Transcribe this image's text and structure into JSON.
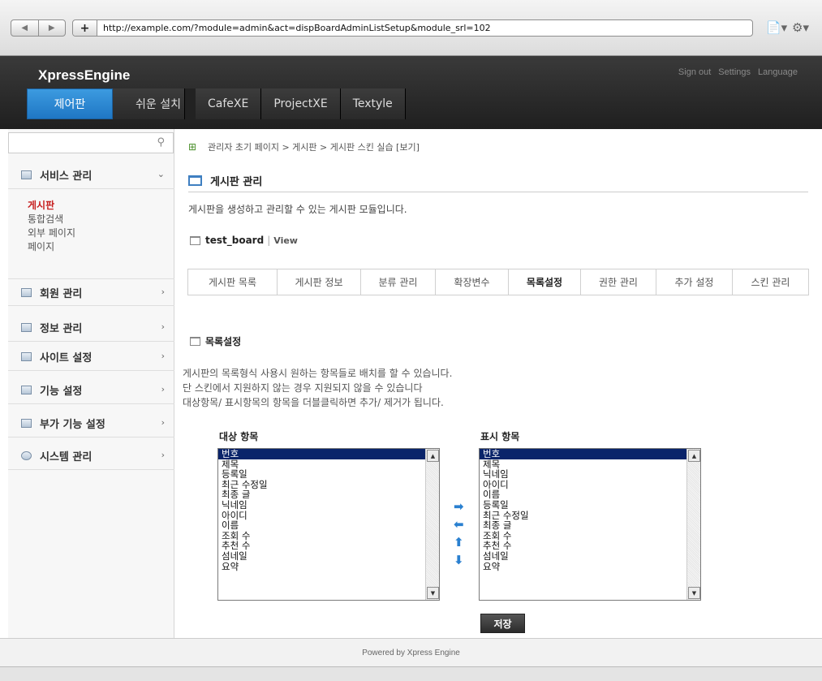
{
  "browser": {
    "url": "http://example.com/?module=admin&act=dispBoardAdminListSetup&module_srl=102",
    "back_icon": "◀",
    "forward_icon": "▶",
    "plus_icon": "+",
    "page_icon": "📄▾",
    "gear_icon": "⚙▾"
  },
  "header": {
    "logo": "XpressEngine",
    "links": [
      "Sign out",
      "Settings",
      "Language"
    ],
    "gnb": [
      "제어판",
      "쉬운 설치",
      "CafeXE",
      "ProjectXE",
      "Textyle"
    ]
  },
  "sidebar": {
    "search_placeholder": "",
    "search_icon": "🔍",
    "sections": [
      {
        "label": "서비스 관리",
        "arrow": "⌄"
      },
      {
        "label": "회원 관리",
        "arrow": "›"
      },
      {
        "label": "정보 관리",
        "arrow": "›"
      },
      {
        "label": "사이트 설정",
        "arrow": "›"
      },
      {
        "label": "기능 설정",
        "arrow": "›"
      },
      {
        "label": "부가 기능 설정",
        "arrow": "›"
      },
      {
        "label": "시스템 관리",
        "arrow": "›"
      }
    ],
    "submenu": [
      "게시판",
      "통합검색",
      "외부 페이지",
      "페이지"
    ]
  },
  "content": {
    "breadcrumb": "관리자 초기 페이지 > 게시판 > 게시판 스킨 실습 [보기]",
    "title": "게시판 관리",
    "description": "게시판을 생성하고 관리할 수 있는 게시판 모듈입니다.",
    "board_name": "test_board",
    "board_sep": "|",
    "board_view": "View",
    "tabs": [
      "게시판 목록",
      "게시판 정보",
      "분류 관리",
      "확장변수",
      "목록설정",
      "권한 관리",
      "추가 설정",
      "스킨 관리"
    ],
    "active_tab": "목록설정",
    "section_title": "목록설정",
    "help": [
      "게시판의 목록형식 사용시 원하는 항목들로 배치를 할 수 있습니다.",
      "단 스킨에서 지원하지 않는 경우 지원되지 않을 수 있습니다",
      "대상항목/ 표시항목의 항목을 더블클릭하면 추가/ 제거가 됩니다."
    ],
    "target_label": "대상 항목",
    "display_label": "표시 항목",
    "target_items": [
      "번호",
      "제목",
      "등록일",
      "최근 수정일",
      "최종 글",
      "닉네임",
      "아이디",
      "이름",
      "조회 수",
      "추천 수",
      "섬네일",
      "요약"
    ],
    "display_items": [
      "번호",
      "제목",
      "닉네임",
      "아이디",
      "이름",
      "등록일",
      "최근 수정일",
      "최종 글",
      "조회 수",
      "추천 수",
      "섬네일",
      "요약"
    ],
    "arrows": [
      "➡",
      "⬅",
      "⬆",
      "⬇"
    ],
    "save_label": "저장"
  },
  "footer": {
    "text": "Powered by Xpress Engine"
  }
}
